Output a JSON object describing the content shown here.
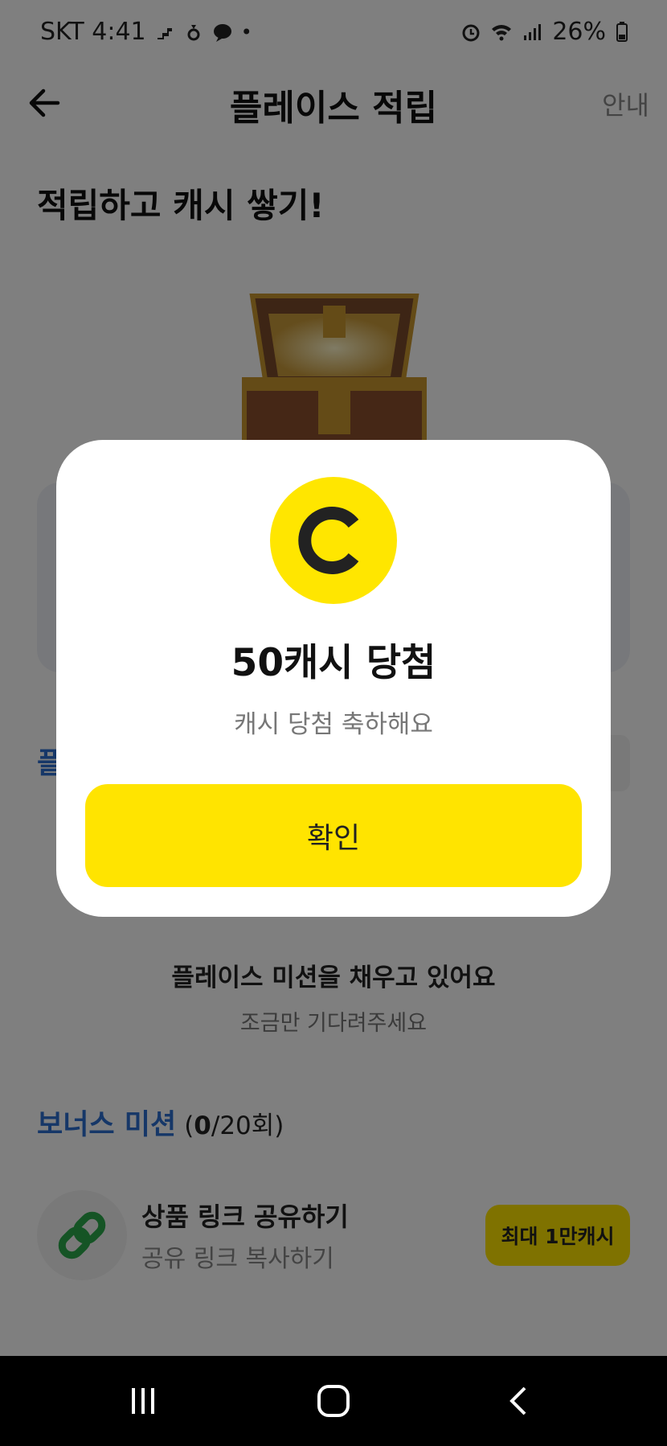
{
  "status_bar": {
    "carrier_time": "SKT 4:41",
    "battery": "26%"
  },
  "header": {
    "title": "플레이스 적립",
    "guide_label": "안내"
  },
  "hero": {
    "title": "적립하고 캐시 쌓기!"
  },
  "behind": {
    "section_label_partial": "플"
  },
  "mission": {
    "title": "플레이스 미션을 채우고 있어요",
    "subtitle": "조금만 기다려주세요"
  },
  "bonus": {
    "title": "보너스 미션",
    "count_open": "(",
    "count_current": "0",
    "count_rest": "/20회)"
  },
  "share_item": {
    "title": "상품 링크 공유하기",
    "subtitle": "공유 링크 복사하기",
    "badge": "최대 1만캐시"
  },
  "modal": {
    "coin_letter": "C",
    "title": "50캐시 당첨",
    "subtitle": "캐시 당첨 축하해요",
    "confirm_label": "확인"
  },
  "colors": {
    "accent_yellow": "#ffe400",
    "link_blue": "#2c6fd1",
    "link_green": "#2aa84a"
  }
}
